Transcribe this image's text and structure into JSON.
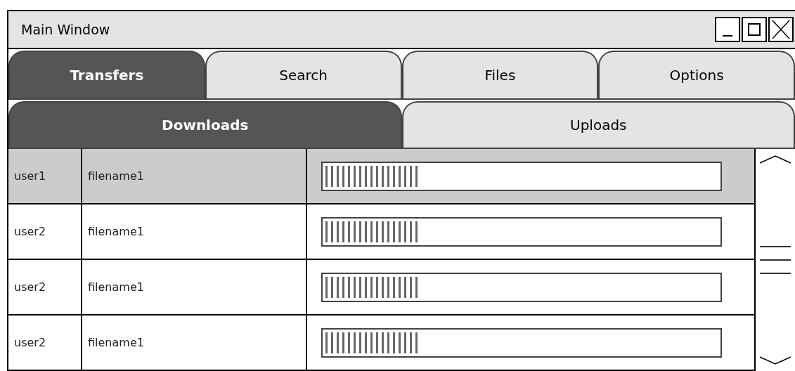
{
  "window": {
    "title": "Main Window"
  },
  "tabs": [
    {
      "label": "Transfers",
      "selected": true
    },
    {
      "label": "Search",
      "selected": false
    },
    {
      "label": "Files",
      "selected": false
    },
    {
      "label": "Options",
      "selected": false
    }
  ],
  "subtabs": [
    {
      "label": "Downloads",
      "selected": true
    },
    {
      "label": "Uploads",
      "selected": false
    }
  ],
  "table": {
    "rows": [
      {
        "user": "user1",
        "file": "filename1",
        "level": 0.24,
        "selected": true
      },
      {
        "user": "user2",
        "file": "filename1",
        "level": 0.24,
        "selected": false
      },
      {
        "user": "user2",
        "file": "filename1",
        "level": 0.24,
        "selected": false
      },
      {
        "user": "user2",
        "file": "filename1",
        "level": 0.24,
        "selected": false
      }
    ]
  }
}
